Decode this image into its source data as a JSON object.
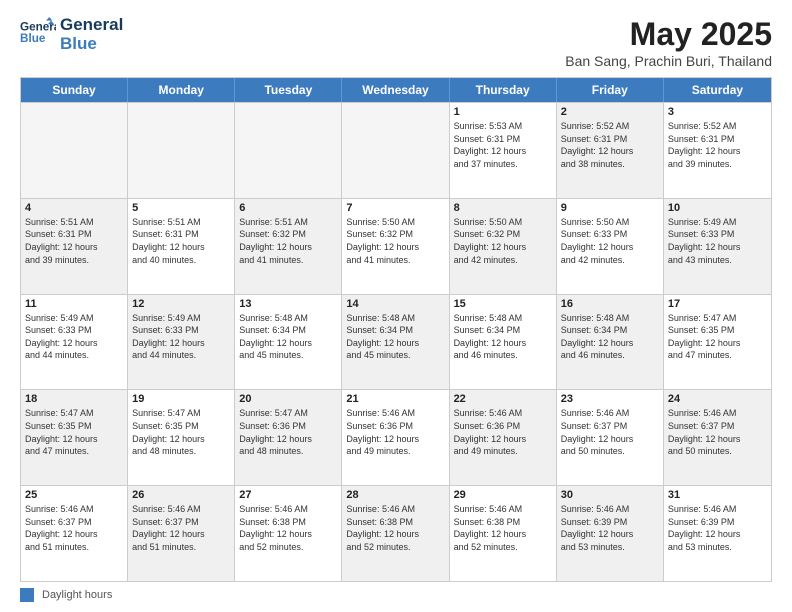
{
  "logo": {
    "line1": "General",
    "line2": "Blue"
  },
  "title": "May 2025",
  "subtitle": "Ban Sang, Prachin Buri, Thailand",
  "days_of_week": [
    "Sunday",
    "Monday",
    "Tuesday",
    "Wednesday",
    "Thursday",
    "Friday",
    "Saturday"
  ],
  "weeks": [
    [
      {
        "day": "",
        "text": "",
        "empty": true
      },
      {
        "day": "",
        "text": "",
        "empty": true
      },
      {
        "day": "",
        "text": "",
        "empty": true
      },
      {
        "day": "",
        "text": "",
        "empty": true
      },
      {
        "day": "1",
        "text": "Sunrise: 5:53 AM\nSunset: 6:31 PM\nDaylight: 12 hours\nand 37 minutes.",
        "shaded": false
      },
      {
        "day": "2",
        "text": "Sunrise: 5:52 AM\nSunset: 6:31 PM\nDaylight: 12 hours\nand 38 minutes.",
        "shaded": true
      },
      {
        "day": "3",
        "text": "Sunrise: 5:52 AM\nSunset: 6:31 PM\nDaylight: 12 hours\nand 39 minutes.",
        "shaded": false
      }
    ],
    [
      {
        "day": "4",
        "text": "Sunrise: 5:51 AM\nSunset: 6:31 PM\nDaylight: 12 hours\nand 39 minutes.",
        "shaded": true
      },
      {
        "day": "5",
        "text": "Sunrise: 5:51 AM\nSunset: 6:31 PM\nDaylight: 12 hours\nand 40 minutes.",
        "shaded": false
      },
      {
        "day": "6",
        "text": "Sunrise: 5:51 AM\nSunset: 6:32 PM\nDaylight: 12 hours\nand 41 minutes.",
        "shaded": true
      },
      {
        "day": "7",
        "text": "Sunrise: 5:50 AM\nSunset: 6:32 PM\nDaylight: 12 hours\nand 41 minutes.",
        "shaded": false
      },
      {
        "day": "8",
        "text": "Sunrise: 5:50 AM\nSunset: 6:32 PM\nDaylight: 12 hours\nand 42 minutes.",
        "shaded": true
      },
      {
        "day": "9",
        "text": "Sunrise: 5:50 AM\nSunset: 6:33 PM\nDaylight: 12 hours\nand 42 minutes.",
        "shaded": false
      },
      {
        "day": "10",
        "text": "Sunrise: 5:49 AM\nSunset: 6:33 PM\nDaylight: 12 hours\nand 43 minutes.",
        "shaded": true
      }
    ],
    [
      {
        "day": "11",
        "text": "Sunrise: 5:49 AM\nSunset: 6:33 PM\nDaylight: 12 hours\nand 44 minutes.",
        "shaded": false
      },
      {
        "day": "12",
        "text": "Sunrise: 5:49 AM\nSunset: 6:33 PM\nDaylight: 12 hours\nand 44 minutes.",
        "shaded": true
      },
      {
        "day": "13",
        "text": "Sunrise: 5:48 AM\nSunset: 6:34 PM\nDaylight: 12 hours\nand 45 minutes.",
        "shaded": false
      },
      {
        "day": "14",
        "text": "Sunrise: 5:48 AM\nSunset: 6:34 PM\nDaylight: 12 hours\nand 45 minutes.",
        "shaded": true
      },
      {
        "day": "15",
        "text": "Sunrise: 5:48 AM\nSunset: 6:34 PM\nDaylight: 12 hours\nand 46 minutes.",
        "shaded": false
      },
      {
        "day": "16",
        "text": "Sunrise: 5:48 AM\nSunset: 6:34 PM\nDaylight: 12 hours\nand 46 minutes.",
        "shaded": true
      },
      {
        "day": "17",
        "text": "Sunrise: 5:47 AM\nSunset: 6:35 PM\nDaylight: 12 hours\nand 47 minutes.",
        "shaded": false
      }
    ],
    [
      {
        "day": "18",
        "text": "Sunrise: 5:47 AM\nSunset: 6:35 PM\nDaylight: 12 hours\nand 47 minutes.",
        "shaded": true
      },
      {
        "day": "19",
        "text": "Sunrise: 5:47 AM\nSunset: 6:35 PM\nDaylight: 12 hours\nand 48 minutes.",
        "shaded": false
      },
      {
        "day": "20",
        "text": "Sunrise: 5:47 AM\nSunset: 6:36 PM\nDaylight: 12 hours\nand 48 minutes.",
        "shaded": true
      },
      {
        "day": "21",
        "text": "Sunrise: 5:46 AM\nSunset: 6:36 PM\nDaylight: 12 hours\nand 49 minutes.",
        "shaded": false
      },
      {
        "day": "22",
        "text": "Sunrise: 5:46 AM\nSunset: 6:36 PM\nDaylight: 12 hours\nand 49 minutes.",
        "shaded": true
      },
      {
        "day": "23",
        "text": "Sunrise: 5:46 AM\nSunset: 6:37 PM\nDaylight: 12 hours\nand 50 minutes.",
        "shaded": false
      },
      {
        "day": "24",
        "text": "Sunrise: 5:46 AM\nSunset: 6:37 PM\nDaylight: 12 hours\nand 50 minutes.",
        "shaded": true
      }
    ],
    [
      {
        "day": "25",
        "text": "Sunrise: 5:46 AM\nSunset: 6:37 PM\nDaylight: 12 hours\nand 51 minutes.",
        "shaded": false
      },
      {
        "day": "26",
        "text": "Sunrise: 5:46 AM\nSunset: 6:37 PM\nDaylight: 12 hours\nand 51 minutes.",
        "shaded": true
      },
      {
        "day": "27",
        "text": "Sunrise: 5:46 AM\nSunset: 6:38 PM\nDaylight: 12 hours\nand 52 minutes.",
        "shaded": false
      },
      {
        "day": "28",
        "text": "Sunrise: 5:46 AM\nSunset: 6:38 PM\nDaylight: 12 hours\nand 52 minutes.",
        "shaded": true
      },
      {
        "day": "29",
        "text": "Sunrise: 5:46 AM\nSunset: 6:38 PM\nDaylight: 12 hours\nand 52 minutes.",
        "shaded": false
      },
      {
        "day": "30",
        "text": "Sunrise: 5:46 AM\nSunset: 6:39 PM\nDaylight: 12 hours\nand 53 minutes.",
        "shaded": true
      },
      {
        "day": "31",
        "text": "Sunrise: 5:46 AM\nSunset: 6:39 PM\nDaylight: 12 hours\nand 53 minutes.",
        "shaded": false
      }
    ]
  ],
  "footer": {
    "legend_label": "Daylight hours"
  }
}
